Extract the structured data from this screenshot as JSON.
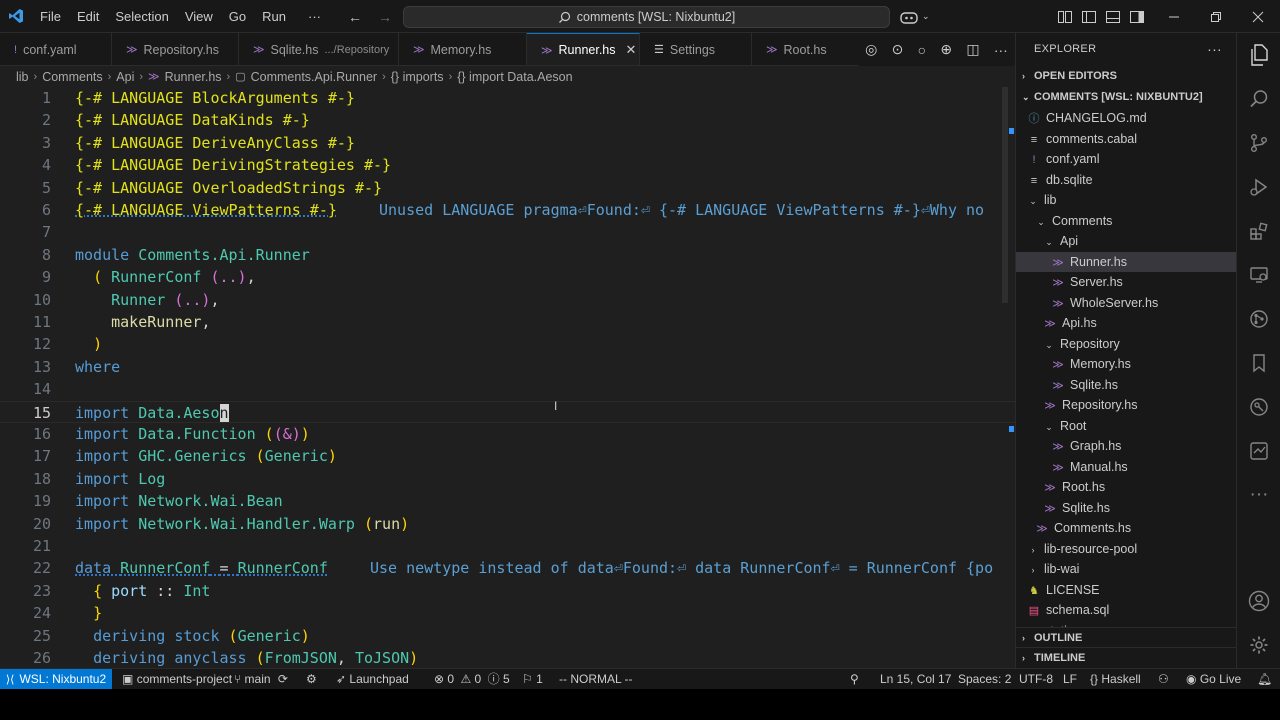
{
  "titlebar": {
    "menu": [
      "File",
      "Edit",
      "Selection",
      "View",
      "Go",
      "Run"
    ],
    "more": "···",
    "back": "←",
    "forward": "→",
    "search_text": "comments [WSL: Nixbuntu2]"
  },
  "tabs": [
    {
      "label": "conf.yaml",
      "icon": "!",
      "desc": ""
    },
    {
      "label": "Repository.hs",
      "icon": "≫",
      "desc": ""
    },
    {
      "label": "Sqlite.hs",
      "icon": "≫",
      "desc": ".../Repository"
    },
    {
      "label": "Memory.hs",
      "icon": "≫",
      "desc": ""
    },
    {
      "label": "Runner.hs",
      "icon": "≫",
      "desc": "",
      "active": true
    },
    {
      "label": "Settings",
      "icon": "☰",
      "desc": ""
    },
    {
      "label": "Root.hs",
      "icon": "≫",
      "desc": ""
    }
  ],
  "breadcrumb": [
    "lib",
    "Comments",
    "Api",
    "Runner.hs",
    "Comments.Api.Runner",
    "{} imports",
    "{} import Data.Aeson"
  ],
  "editor": {
    "line_numbers": [
      "1",
      "2",
      "3",
      "4",
      "5",
      "6",
      "7",
      "8",
      "9",
      "10",
      "11",
      "12",
      "13",
      "14",
      "15",
      "16",
      "17",
      "18",
      "19",
      "20",
      "21",
      "22",
      "23",
      "24",
      "25",
      "26"
    ],
    "hint_line6": "Unused LANGUAGE pragma⏎Found:⏎ {-# LANGUAGE ViewPatterns #-}⏎Why no",
    "hint_line22": "Use newtype instead of data⏎Found:⏎ data RunnerConf⏎ = RunnerConf {po"
  },
  "sidebar": {
    "title": "EXPLORER",
    "more": "···",
    "open_editors": "OPEN EDITORS",
    "workspace": "COMMENTS [WSL: NIXBUNTU2]",
    "outline": "OUTLINE",
    "timeline": "TIMELINE",
    "tree": [
      {
        "label": "CHANGELOG.md",
        "icon": "ⓘ",
        "cls": "ic-md",
        "depth": 0,
        "chev": ""
      },
      {
        "label": "comments.cabal",
        "icon": "≡",
        "cls": "ic-cabal",
        "depth": 0,
        "chev": ""
      },
      {
        "label": "conf.yaml",
        "icon": "!",
        "cls": "ic-yaml",
        "depth": 0,
        "chev": ""
      },
      {
        "label": "db.sqlite",
        "icon": "≡",
        "cls": "ic-db",
        "depth": 0,
        "chev": ""
      },
      {
        "label": "lib",
        "icon": "",
        "cls": "",
        "depth": 0,
        "chev": "⌄"
      },
      {
        "label": "Comments",
        "icon": "",
        "cls": "",
        "depth": 1,
        "chev": "⌄"
      },
      {
        "label": "Api",
        "icon": "",
        "cls": "",
        "depth": 2,
        "chev": "⌄"
      },
      {
        "label": "Runner.hs",
        "icon": "≫",
        "cls": "ic-hs",
        "depth": 3,
        "chev": "",
        "selected": true
      },
      {
        "label": "Server.hs",
        "icon": "≫",
        "cls": "ic-hs",
        "depth": 3,
        "chev": ""
      },
      {
        "label": "WholeServer.hs",
        "icon": "≫",
        "cls": "ic-hs",
        "depth": 3,
        "chev": ""
      },
      {
        "label": "Api.hs",
        "icon": "≫",
        "cls": "ic-hs",
        "depth": 2,
        "chev": ""
      },
      {
        "label": "Repository",
        "icon": "",
        "cls": "",
        "depth": 2,
        "chev": "⌄"
      },
      {
        "label": "Memory.hs",
        "icon": "≫",
        "cls": "ic-hs",
        "depth": 3,
        "chev": ""
      },
      {
        "label": "Sqlite.hs",
        "icon": "≫",
        "cls": "ic-hs",
        "depth": 3,
        "chev": ""
      },
      {
        "label": "Repository.hs",
        "icon": "≫",
        "cls": "ic-hs",
        "depth": 2,
        "chev": ""
      },
      {
        "label": "Root",
        "icon": "",
        "cls": "",
        "depth": 2,
        "chev": "⌄"
      },
      {
        "label": "Graph.hs",
        "icon": "≫",
        "cls": "ic-hs",
        "depth": 3,
        "chev": ""
      },
      {
        "label": "Manual.hs",
        "icon": "≫",
        "cls": "ic-hs",
        "depth": 3,
        "chev": ""
      },
      {
        "label": "Root.hs",
        "icon": "≫",
        "cls": "ic-hs",
        "depth": 2,
        "chev": ""
      },
      {
        "label": "Sqlite.hs",
        "icon": "≫",
        "cls": "ic-hs",
        "depth": 2,
        "chev": ""
      },
      {
        "label": "Comments.hs",
        "icon": "≫",
        "cls": "ic-hs",
        "depth": 1,
        "chev": ""
      },
      {
        "label": "lib-resource-pool",
        "icon": "",
        "cls": "",
        "depth": 0,
        "chev": "›"
      },
      {
        "label": "lib-wai",
        "icon": "",
        "cls": "",
        "depth": 0,
        "chev": "›"
      },
      {
        "label": "LICENSE",
        "icon": "♞",
        "cls": "ic-lic",
        "depth": 0,
        "chev": ""
      },
      {
        "label": "schema.sql",
        "icon": "▤",
        "cls": "ic-sql",
        "depth": 0,
        "chev": ""
      },
      {
        "label": "static",
        "icon": "",
        "cls": "",
        "depth": 0,
        "chev": "›"
      }
    ]
  },
  "statusbar": {
    "remote": "WSL: Nixbuntu2",
    "project": "comments-project",
    "branch": "main",
    "launchpad": "Launchpad",
    "errors": "0",
    "warnings": "0",
    "infos": "5",
    "ports": "1",
    "mode": "-- NORMAL --",
    "position": "Ln 15, Col 17",
    "spaces": "Spaces: 2",
    "encoding": "UTF-8",
    "eol": "LF",
    "language": "Haskell",
    "golive": "Go Live"
  },
  "colors": {
    "accent": "#0078d4",
    "editor_bg": "#1f1f1f",
    "chrome_bg": "#181818",
    "pragma": "#e2e21a",
    "keyword": "#569cd6"
  }
}
